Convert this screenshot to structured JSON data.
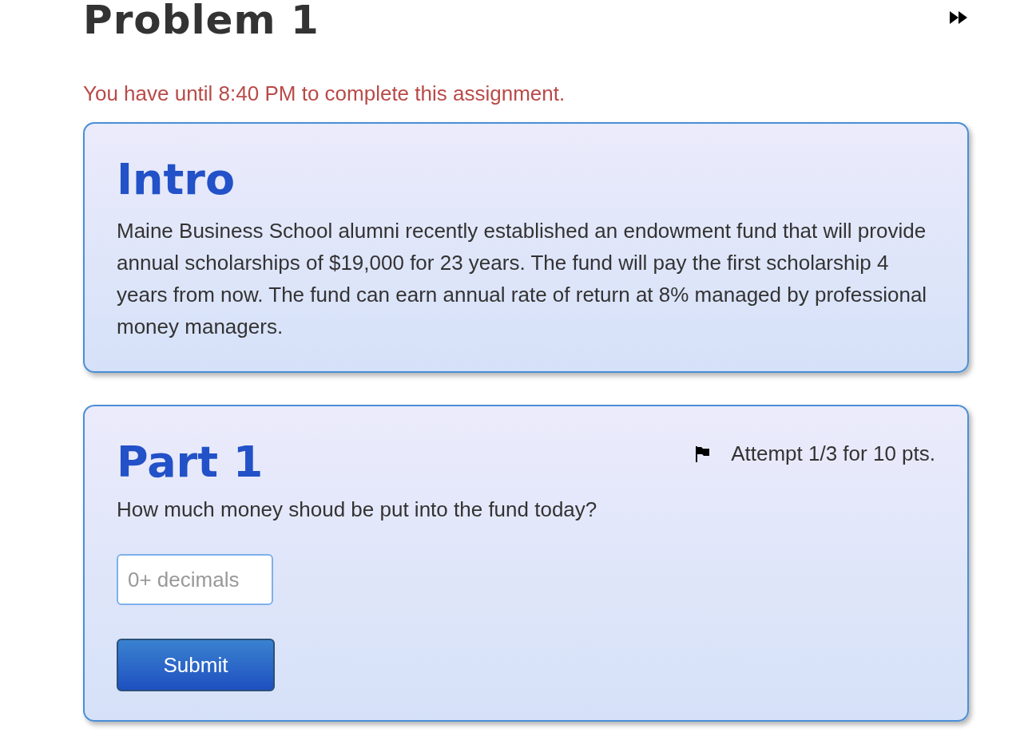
{
  "title": "Problem 1",
  "deadline": "You have until 8:40 PM to complete this assignment.",
  "intro": {
    "heading": "Intro",
    "text": "Maine Business School alumni recently established an endowment fund that will provide annual scholarships of $19,000 for 23 years. The fund will pay the first scholarship 4 years from now. The fund can earn annual rate of return at 8% managed by professional money managers."
  },
  "parts": [
    {
      "heading": "Part 1",
      "attempt": "Attempt 1/3 for 10 pts.",
      "question": "How much money shoud be put into the fund today?",
      "placeholder": "0+ decimals",
      "button": "Submit"
    }
  ]
}
